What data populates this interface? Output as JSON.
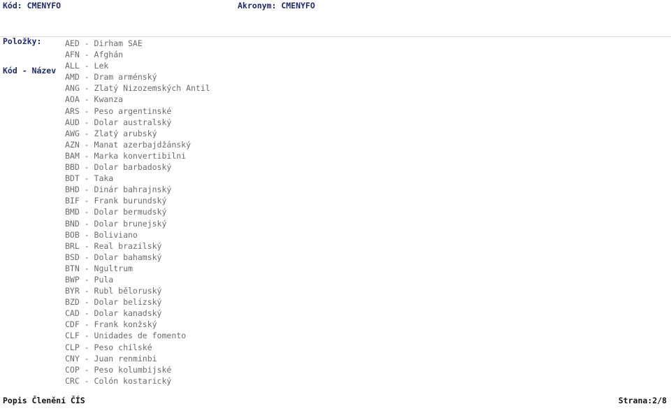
{
  "header": {
    "code_label": "Kód:",
    "code_value": "CMENYFO",
    "code_line": "Kód: CMENYFO",
    "acronym_label": "Akronym:",
    "acronym_value": "CMENYFO",
    "acronym_line": "Akronym: CMENYFO",
    "accent_color": "#1f2a6e"
  },
  "subheader": {
    "items_label": "Položky:",
    "columns_label": "Kód - Název"
  },
  "list": {
    "separator": " - ",
    "text_color": "#6b6b6b",
    "entries": [
      {
        "code": "AED",
        "name": "Dirham SAE",
        "line": "AED - Dirham SAE"
      },
      {
        "code": "AFN",
        "name": "Afghán",
        "line": "AFN - Afghán"
      },
      {
        "code": "ALL",
        "name": "Lek",
        "line": "ALL - Lek"
      },
      {
        "code": "AMD",
        "name": "Dram arménský",
        "line": "AMD - Dram arménský"
      },
      {
        "code": "ANG",
        "name": "Zlatý Nizozemských Antil",
        "line": "ANG - Zlatý Nizozemských Antil"
      },
      {
        "code": "AOA",
        "name": "Kwanza",
        "line": "AOA - Kwanza"
      },
      {
        "code": "ARS",
        "name": "Peso argentinské",
        "line": "ARS - Peso argentinské"
      },
      {
        "code": "AUD",
        "name": "Dolar australský",
        "line": "AUD - Dolar australský"
      },
      {
        "code": "AWG",
        "name": "Zlatý arubský",
        "line": "AWG - Zlatý arubský"
      },
      {
        "code": "AZN",
        "name": "Manat azerbajdžánský",
        "line": "AZN - Manat azerbajdžánský"
      },
      {
        "code": "BAM",
        "name": "Marka konvertibilni",
        "line": "BAM - Marka konvertibilni"
      },
      {
        "code": "BBD",
        "name": "Dolar barbadoský",
        "line": "BBD - Dolar barbadoský"
      },
      {
        "code": "BDT",
        "name": "Taka",
        "line": "BDT - Taka"
      },
      {
        "code": "BHD",
        "name": "Dinár bahrajnský",
        "line": "BHD - Dinár bahrajnský"
      },
      {
        "code": "BIF",
        "name": "Frank burundský",
        "line": "BIF - Frank burundský"
      },
      {
        "code": "BMD",
        "name": "Dolar bermudský",
        "line": "BMD - Dolar bermudský"
      },
      {
        "code": "BND",
        "name": "Dolar brunejský",
        "line": "BND - Dolar brunejský"
      },
      {
        "code": "BOB",
        "name": "Boliviano",
        "line": "BOB - Boliviano"
      },
      {
        "code": "BRL",
        "name": "Real brazilský",
        "line": "BRL - Real brazilský"
      },
      {
        "code": "BSD",
        "name": "Dolar bahamský",
        "line": "BSD - Dolar bahamský"
      },
      {
        "code": "BTN",
        "name": "Ngultrum",
        "line": "BTN - Ngultrum"
      },
      {
        "code": "BWP",
        "name": "Pula",
        "line": "BWP - Pula"
      },
      {
        "code": "BYR",
        "name": "Rubl běloruský",
        "line": "BYR - Rubl běloruský"
      },
      {
        "code": "BZD",
        "name": "Dolar belizský",
        "line": "BZD - Dolar belizský"
      },
      {
        "code": "CAD",
        "name": "Dolar kanadský",
        "line": "CAD - Dolar kanadský"
      },
      {
        "code": "CDF",
        "name": "Frank konžský",
        "line": "CDF - Frank konžský"
      },
      {
        "code": "CLF",
        "name": "Unidades de fomento",
        "line": "CLF - Unidades de fomento"
      },
      {
        "code": "CLP",
        "name": "Peso chilské",
        "line": "CLP - Peso chilské"
      },
      {
        "code": "CNY",
        "name": "Juan renminbi",
        "line": "CNY - Juan renminbi"
      },
      {
        "code": "COP",
        "name": "Peso kolumbijské",
        "line": "COP - Peso kolumbijské"
      },
      {
        "code": "CRC",
        "name": "Colón kostarický",
        "line": "CRC - Colón kostarický"
      }
    ]
  },
  "footer": {
    "left": "Popis Členění ČÍS",
    "page_label": "Strana:",
    "page_current": "2",
    "page_total": "8",
    "right": "Strana:2/8"
  }
}
